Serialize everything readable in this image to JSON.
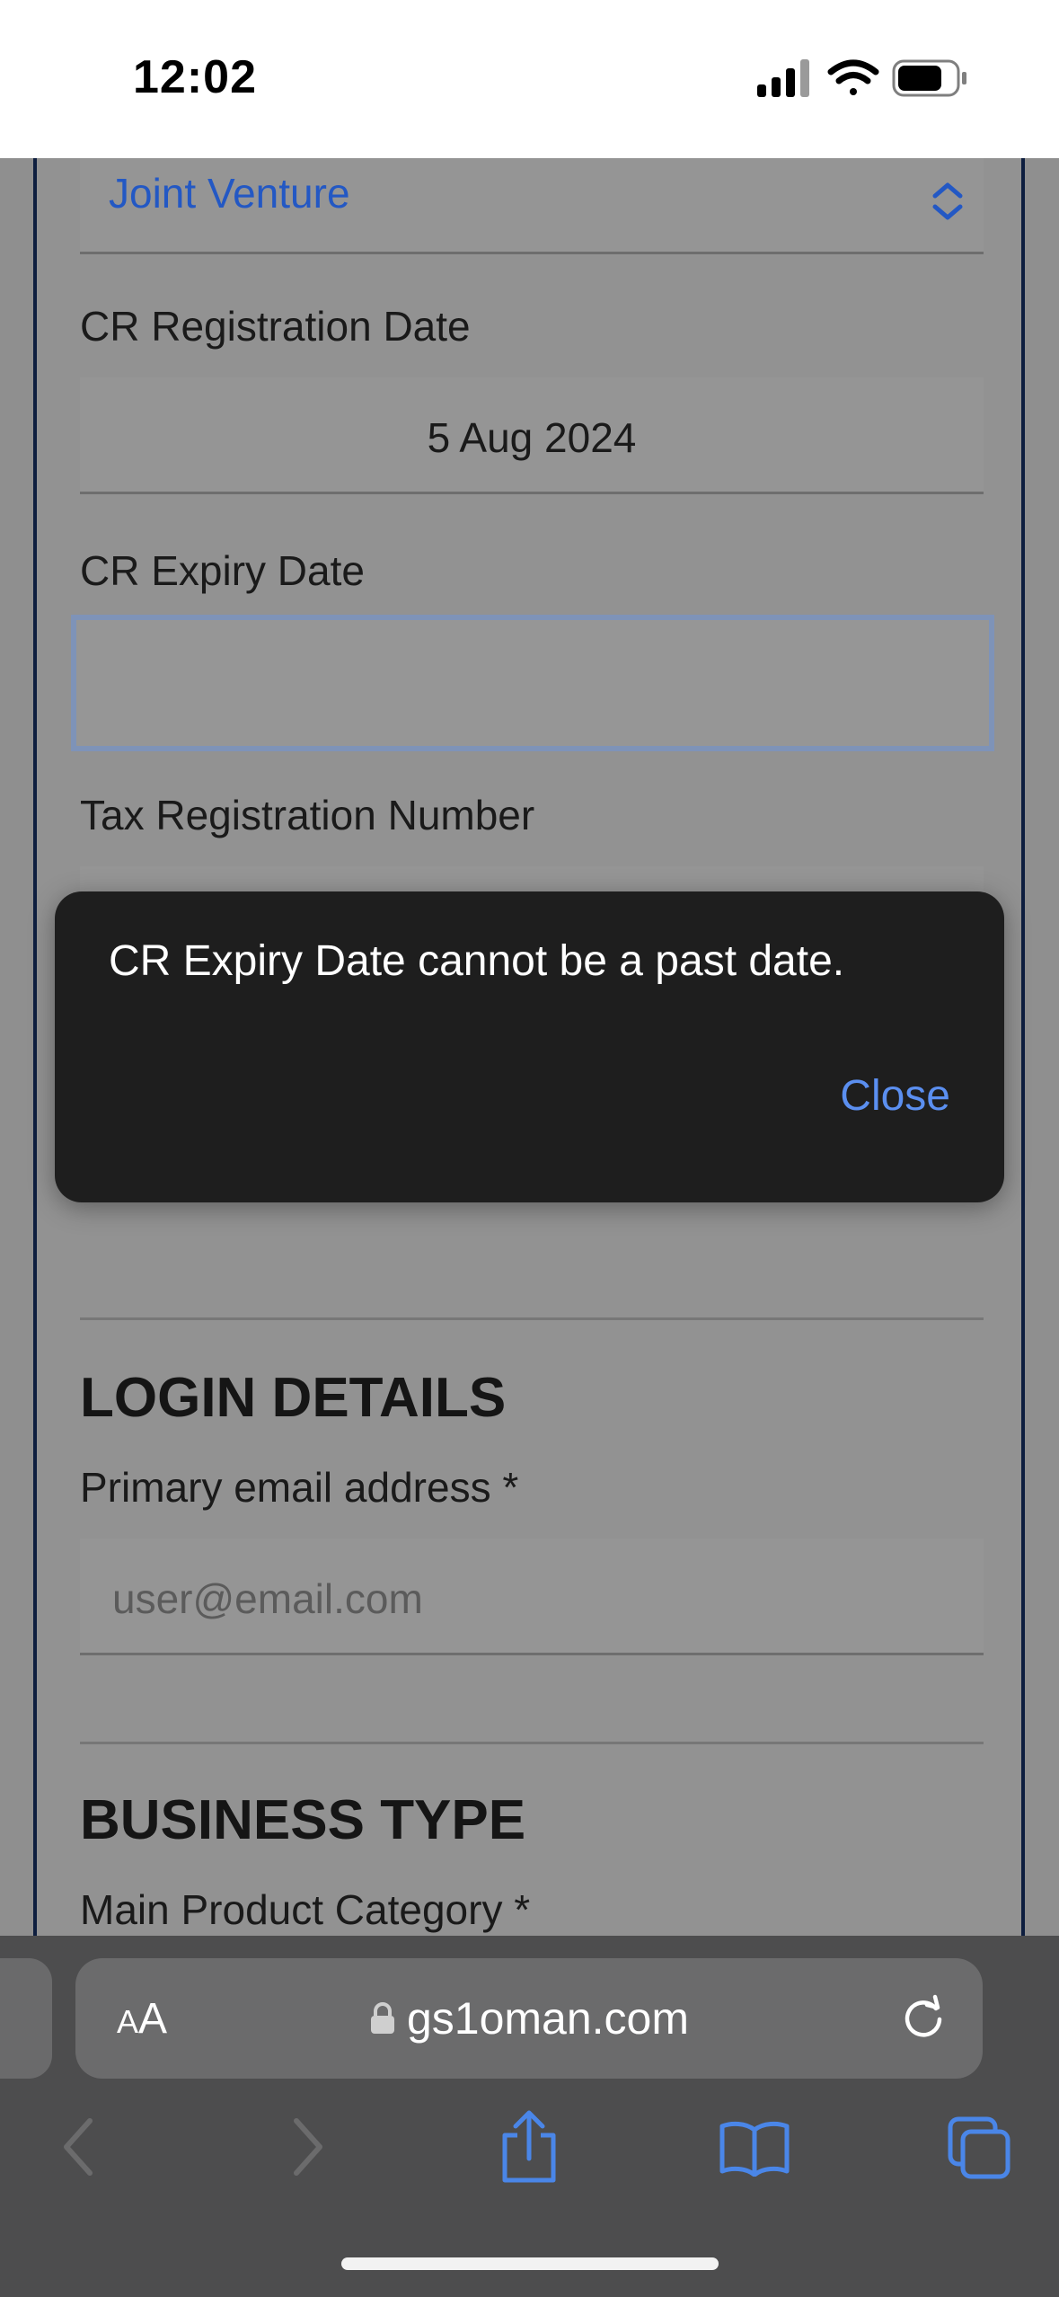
{
  "status_bar": {
    "time": "12:02"
  },
  "form": {
    "entity_type": {
      "value": "Joint Venture"
    },
    "cr_registration_date": {
      "label": "CR Registration Date",
      "value": "5 Aug 2024"
    },
    "cr_expiry_date": {
      "label": "CR Expiry Date",
      "value": ""
    },
    "tax_registration_number": {
      "label": "Tax Registration Number"
    }
  },
  "login_details": {
    "heading": "LOGIN DETAILS",
    "email_label": "Primary email address *",
    "email_placeholder": "user@email.com"
  },
  "business_type": {
    "heading": "BUSINESS TYPE",
    "main_product_category_label": "Main Product Category *"
  },
  "alert": {
    "message": "CR Expiry Date cannot be a past date.",
    "close_label": "Close"
  },
  "browser": {
    "text_size_small": "A",
    "text_size_large": "A",
    "url": "gs1oman.com",
    "icons": [
      "lock-icon",
      "reload-icon",
      "back-icon",
      "forward-icon",
      "share-icon",
      "bookmarks-icon",
      "tabs-icon"
    ]
  },
  "colors": {
    "link": "#5b8ff0",
    "select_value": "#2358c4",
    "alert_bg": "#1e1e1e"
  }
}
